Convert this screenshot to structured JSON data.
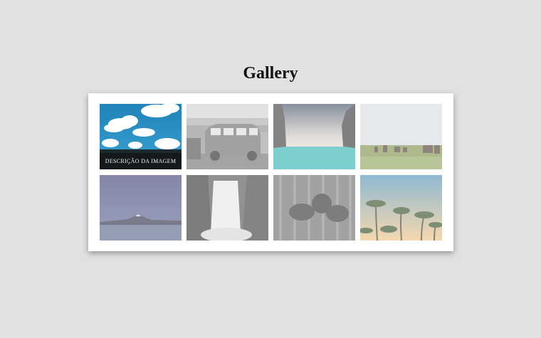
{
  "page": {
    "title": "Gallery"
  },
  "gallery": {
    "items": [
      {
        "subject": "sky-clouds",
        "caption": "DESCRIÇÃO DA IMAGEM",
        "state": "hover"
      },
      {
        "subject": "vintage-van",
        "state": "faded"
      },
      {
        "subject": "sea-cliffs",
        "state": "faded"
      },
      {
        "subject": "horses-field",
        "state": "faded"
      },
      {
        "subject": "mountain-lake",
        "state": "faded"
      },
      {
        "subject": "waterfall",
        "state": "faded"
      },
      {
        "subject": "pine-cones",
        "state": "faded"
      },
      {
        "subject": "palm-trees",
        "state": "faded"
      }
    ]
  },
  "colors": {
    "background": "#e1e1e1",
    "card": "#ffffff",
    "caption_overlay": "#141414"
  }
}
